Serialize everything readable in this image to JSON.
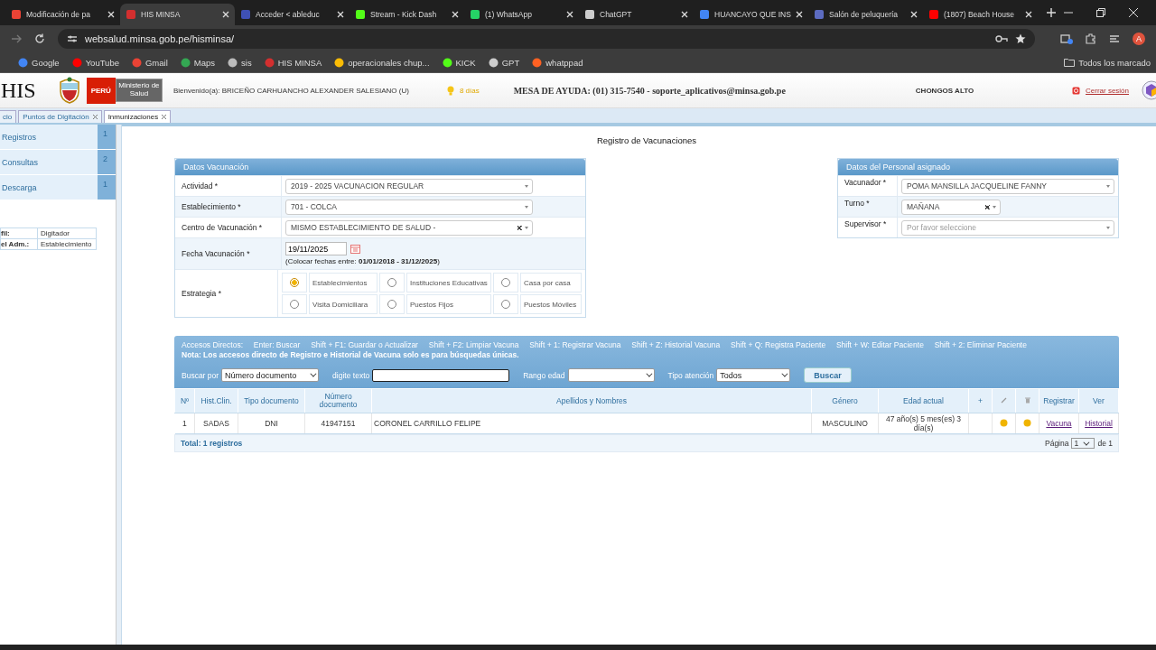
{
  "browser": {
    "tabs": [
      {
        "title": "Modificación de pa",
        "selected": false,
        "color": "#ea4335"
      },
      {
        "title": "HIS MINSA",
        "selected": true,
        "color": "#d32f2f"
      },
      {
        "title": "Acceder < ableduc",
        "selected": false,
        "color": "#3f51b5"
      },
      {
        "title": "Stream - Kick Dash",
        "selected": false,
        "color": "#53fc18"
      },
      {
        "title": "(1) WhatsApp",
        "selected": false,
        "color": "#25d366"
      },
      {
        "title": "ChatGPT",
        "selected": false,
        "color": "#cccccc"
      },
      {
        "title": "HUANCAYO QUE INS",
        "selected": false,
        "color": "#4285f4"
      },
      {
        "title": "Salón de peluquería",
        "selected": false,
        "color": "#5c6bc0"
      },
      {
        "title": "(1807) Beach House",
        "selected": false,
        "color": "#ff0000"
      }
    ],
    "url": "websalud.minsa.gob.pe/hisminsa/",
    "profile_initial": "A",
    "bookmarks": [
      {
        "label": "Google",
        "color": "#4285f4"
      },
      {
        "label": "YouTube",
        "color": "#ff0000"
      },
      {
        "label": "Gmail",
        "color": "#ea4335"
      },
      {
        "label": "Maps",
        "color": "#34a853"
      },
      {
        "label": "sis",
        "color": "#bbbbbb"
      },
      {
        "label": "HIS MINSA",
        "color": "#d32f2f"
      },
      {
        "label": "operacionales chup...",
        "color": "#fbbc05"
      },
      {
        "label": "KICK",
        "color": "#53fc18"
      },
      {
        "label": "GPT",
        "color": "#cccccc"
      },
      {
        "label": "whatppad",
        "color": "#ff6122"
      }
    ],
    "all_bookmarks": "Todos los marcado"
  },
  "header": {
    "logo": "HIS",
    "country": "PERÚ",
    "ministry": "Ministerio de Salud",
    "welcome": "Bienvenido(a): BRICEÑO CARHUANCHO ALEXANDER SALESIANO (U)",
    "days": "8 días",
    "help": "MESA DE AYUDA: (01) 315-7540 - soporte_aplicativos@minsa.gob.pe",
    "location": "CHONGOS ALTO",
    "logout": "Cerrar sesión"
  },
  "app_tabs": [
    {
      "label": "cio",
      "selected": false,
      "closable": false
    },
    {
      "label": "Puntos de Digitación",
      "selected": false,
      "closable": true
    },
    {
      "label": "Inmunizaciones",
      "selected": true,
      "closable": true
    }
  ],
  "sidebar": {
    "items": [
      {
        "label": "Registros",
        "count": "1"
      },
      {
        "label": "Consultas",
        "count": "2"
      },
      {
        "label": "Descarga",
        "count": "1"
      }
    ],
    "profile": [
      {
        "label": "fil:",
        "value": "Digitador"
      },
      {
        "label": "el Adm.:",
        "value": "Establecimiento"
      }
    ]
  },
  "title": "Registro de Vacunaciones",
  "vaccination": {
    "title": "Datos Vacunación",
    "activity": {
      "label": "Actividad *",
      "value": "2019 - 2025 VACUNACION REGULAR"
    },
    "facility": {
      "label": "Establecimiento *",
      "value": "701 - COLCA"
    },
    "center": {
      "label": "Centro de Vacunación *",
      "value": "MISMO ESTABLECIMIENTO DE SALUD -"
    },
    "date": {
      "label": "Fecha Vacunación *",
      "value": "19/11/2025",
      "hint": "(Colocar fechas entre: **01/01/2018 - 31/12/2025**)"
    },
    "strategy": {
      "label": "Estrategia *",
      "options": [
        {
          "label": "Establecimientos",
          "selected": true
        },
        {
          "label": "Instituciones Educativas",
          "selected": false
        },
        {
          "label": "Casa por casa",
          "selected": false
        },
        {
          "label": "Visita Domiciliara",
          "selected": false
        },
        {
          "label": "Puestos Fijos",
          "selected": false
        },
        {
          "label": "Puestos Móviles",
          "selected": false
        }
      ]
    }
  },
  "staff": {
    "title": "Datos del Personal asignado",
    "vaccinator": {
      "label": "Vacunador *",
      "value": "POMA MANSILLA JACQUELINE FANNY"
    },
    "shift": {
      "label": "Turno *",
      "value": "MAÑANA"
    },
    "supervisor": {
      "label": "Supervisor *",
      "placeholder": "Por favor seleccione"
    }
  },
  "search": {
    "shortcuts": "Accesos Directos:     Enter: Buscar     Shift + F1: Guardar o Actualizar     Shift + F2: Limpiar Vacuna     Shift + 1: Registrar Vacuna     Shift + Z: Historial Vacuna     Shift + Q: Registra Paciente     Shift + W: Editar Paciente     Shift + 2: Eliminar Paciente",
    "note": "Nota: Los accesos directo de Registro e Historial de Vacuna solo es para búsquedas únicas.",
    "search_by_label": "Buscar por",
    "search_by": "Número documento",
    "text_label": "digite texto",
    "age_label": "Rango edad",
    "care_label": "Tipo atención",
    "care": "Todos",
    "button": "Buscar"
  },
  "table": {
    "columns": [
      {
        "kind": "text",
        "label": "Nº"
      },
      {
        "kind": "text",
        "label": "Hist.Clin."
      },
      {
        "kind": "text",
        "label": "Tipo documento"
      },
      {
        "kind": "text",
        "label": "Número documento"
      },
      {
        "kind": "text",
        "label": "Apellidos y Nombres"
      },
      {
        "kind": "text",
        "label": "Género"
      },
      {
        "kind": "text",
        "label": "Edad actual"
      },
      {
        "kind": "text",
        "label": "+"
      },
      {
        "kind": "edit"
      },
      {
        "kind": "trash"
      },
      {
        "kind": "text",
        "label": "Registrar"
      },
      {
        "kind": "text",
        "label": "Ver"
      }
    ],
    "rows": [
      [
        {
          "kind": "text",
          "text": "1"
        },
        {
          "kind": "text",
          "text": "SADAS"
        },
        {
          "kind": "text",
          "text": "DNI"
        },
        {
          "kind": "text",
          "text": "41947151"
        },
        {
          "kind": "text",
          "text": "CORONEL CARRILLO FELIPE"
        },
        {
          "kind": "text",
          "text": "MASCULINO"
        },
        {
          "kind": "text",
          "text": "47 año(s) 5 mes(es) 3 día(s)"
        },
        {
          "kind": "blank"
        },
        {
          "kind": "dot",
          "color": "#f0b400"
        },
        {
          "kind": "dot",
          "color": "#f0b400"
        },
        {
          "kind": "link",
          "text": "Vacuna"
        },
        {
          "kind": "link",
          "text": "Historial"
        }
      ]
    ],
    "total": "Total: 1 registros",
    "page_label": "Página",
    "page": "1",
    "page_of": "de 1"
  }
}
